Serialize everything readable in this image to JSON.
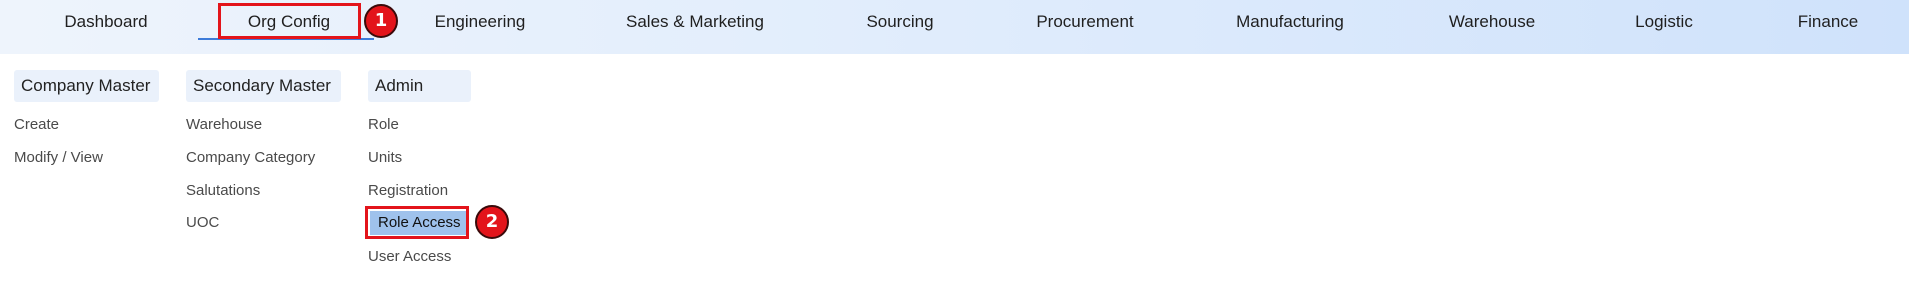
{
  "nav": {
    "items": [
      {
        "label": "Dashboard"
      },
      {
        "label": "Org Config"
      },
      {
        "label": "Engineering"
      },
      {
        "label": "Sales & Marketing"
      },
      {
        "label": "Sourcing"
      },
      {
        "label": "Procurement"
      },
      {
        "label": "Manufacturing"
      },
      {
        "label": "Warehouse"
      },
      {
        "label": "Logistic"
      },
      {
        "label": "Finance"
      }
    ],
    "active": "Org Config"
  },
  "annotations": {
    "badge1": "1",
    "badge2": "2",
    "color": "#e3141b"
  },
  "menu": {
    "company_master": {
      "header": "Company Master",
      "items": [
        "Create",
        "Modify / View"
      ]
    },
    "secondary_master": {
      "header": "Secondary Master",
      "items": [
        "Warehouse",
        "Company Category",
        "Salutations",
        "UOC"
      ]
    },
    "admin": {
      "header": "Admin",
      "items": [
        "Role",
        "Units",
        "Registration",
        "Role Access",
        "User Access"
      ],
      "selected": "Role Access"
    }
  },
  "colors": {
    "accent": "#3d7bd9",
    "header_bg": "#eaf1fb",
    "selected_bg": "#9fc2ec"
  }
}
